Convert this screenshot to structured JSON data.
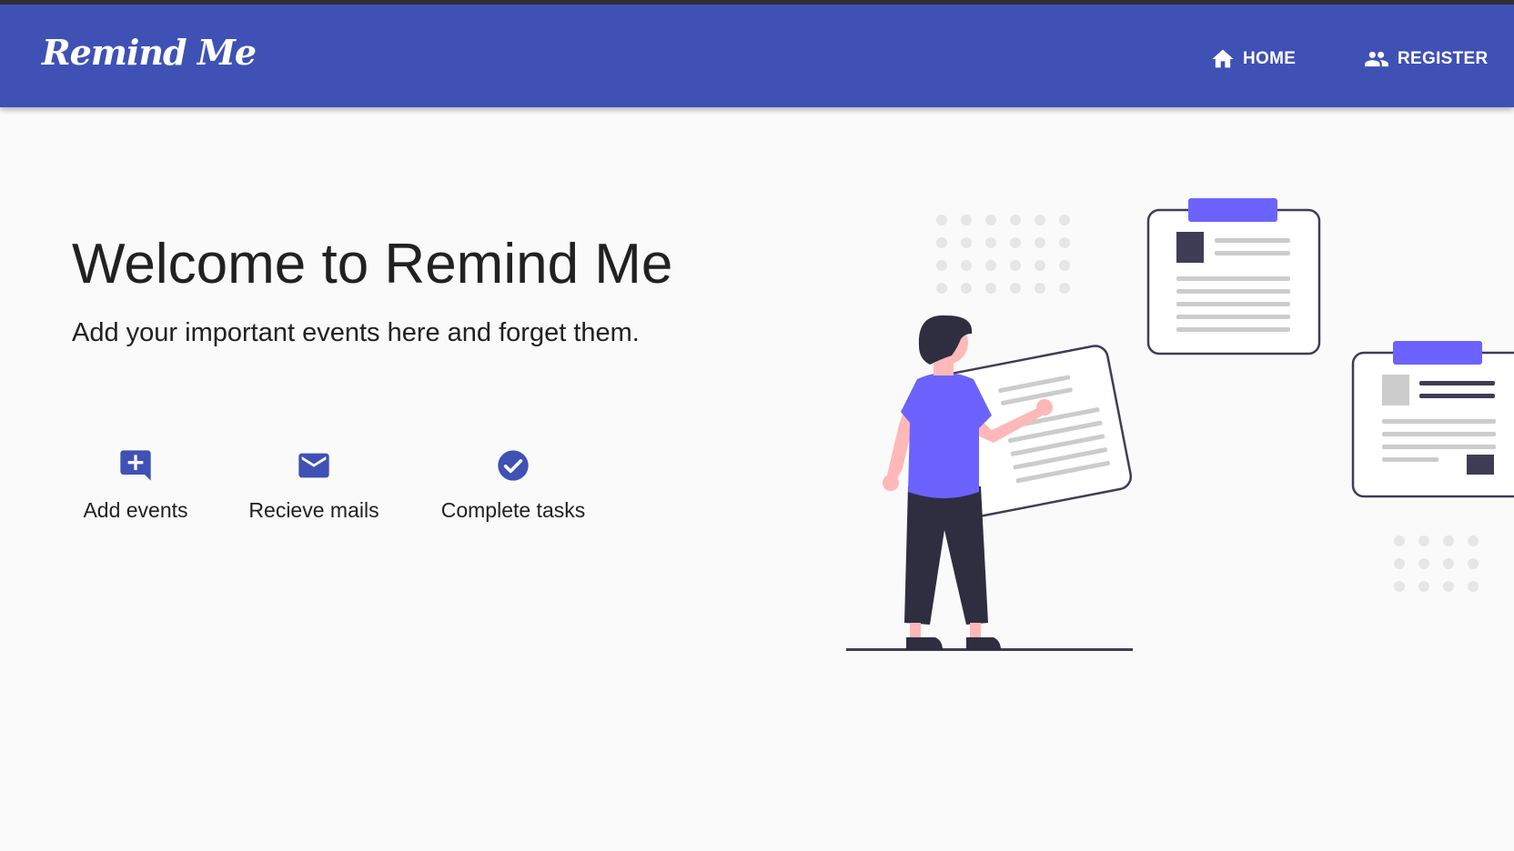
{
  "app": {
    "logo_text": "Remind Me",
    "accent_color": "#3f51b5",
    "illustration_accent": "#6c63ff"
  },
  "nav": [
    {
      "label": "HOME",
      "icon": "home-icon"
    },
    {
      "label": "REGISTER",
      "icon": "people-icon"
    }
  ],
  "hero": {
    "title": "Welcome to Remind Me",
    "subtitle": "Add your important events here and forget them."
  },
  "features": [
    {
      "label": "Add events",
      "icon": "add-comment-icon"
    },
    {
      "label": "Recieve mails",
      "icon": "mail-icon"
    },
    {
      "label": "Complete tasks",
      "icon": "check-circle-icon"
    }
  ]
}
